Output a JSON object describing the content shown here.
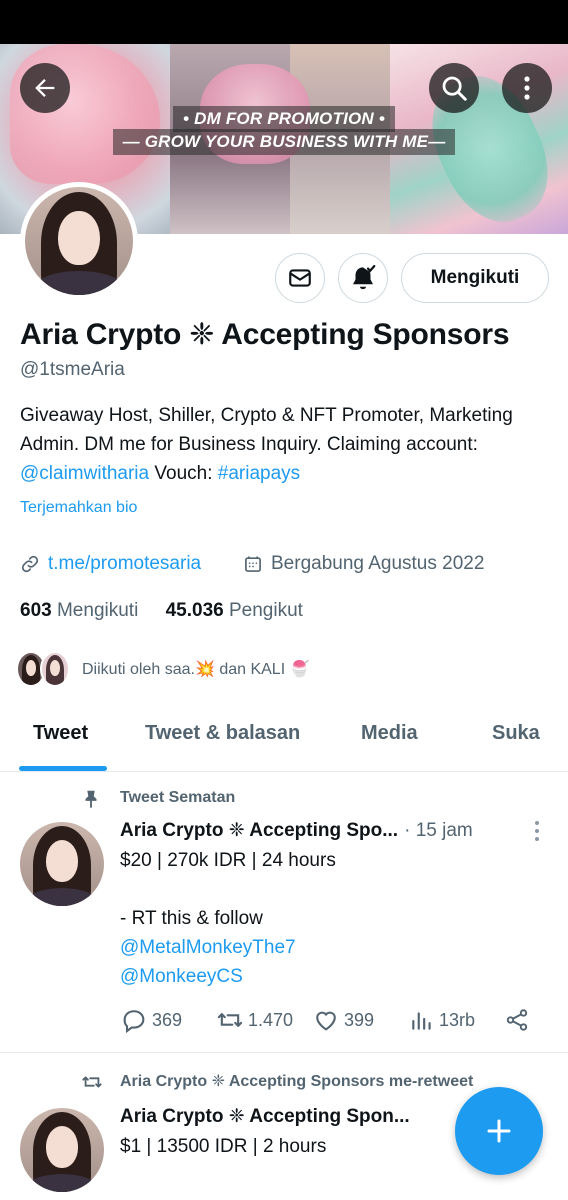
{
  "banner": {
    "promo_line1": "• DM FOR PROMOTION •",
    "promo_line2": "— GROW YOUR BUSINESS WITH ME—"
  },
  "profile": {
    "name": "Aria Crypto ❈ Accepting Sponsors",
    "handle": "@1tsmeAria",
    "bio_text1": "Giveaway Host, Shiller, Crypto & NFT Promoter, Marketing Admin. DM me for Business Inquiry. Claiming account: ",
    "bio_mention": "@claimwitharia",
    "bio_text2": " Vouch: ",
    "bio_hashtag": "#ariapays",
    "translate_bio": "Terjemahkan bio",
    "website": "t.me/promotesaria",
    "joined": "Bergabung Agustus 2022",
    "following_count": "603",
    "following_label": "Mengikuti",
    "followers_count": "45.036",
    "followers_label": "Pengikut",
    "followed_by": "Diikuti oleh saa.💥 dan KALI 🍧",
    "follow_button": "Mengikuti"
  },
  "tabs": [
    "Tweet",
    "Tweet & balasan",
    "Media",
    "Suka"
  ],
  "tweets": [
    {
      "context": "Tweet Sematan",
      "name": "Aria Crypto ❈ Accepting Spo...",
      "time": "· 15 jam",
      "lines": [
        "$20 | 270k IDR | 24 hours",
        "",
        "- RT this & follow"
      ],
      "mentions": [
        "@MetalMonkeyThe7",
        "@MonkeeyCS"
      ],
      "replies": "369",
      "retweets": "1.470",
      "likes": "399",
      "views": "13rb"
    },
    {
      "context": "Aria Crypto ❈ Accepting Sponsors me-retweet",
      "name": "Aria Crypto ❈ Accepting Spon...",
      "lines": [
        "$1 | 13500 IDR | 2 hours"
      ]
    }
  ],
  "colors": {
    "accent": "#1d9bf0",
    "text": "#0f1419",
    "muted": "#536471",
    "border": "#cfd9de"
  }
}
